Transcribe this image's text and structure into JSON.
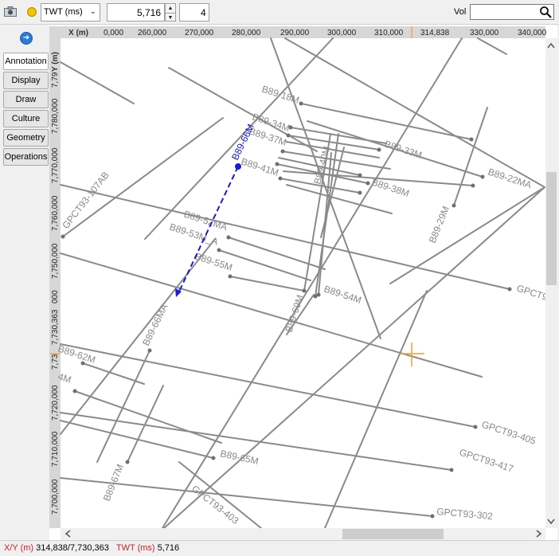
{
  "toolbar": {
    "domain_select": "TWT (ms)",
    "time_value": "5,716",
    "step_value": "4",
    "vol_label": "Vol",
    "vol_value": ""
  },
  "sidetabs": [
    "Annotation",
    "Display",
    "Draw",
    "Culture",
    "Geometry",
    "Operations"
  ],
  "axes": {
    "x_title": "X (m)",
    "y_title": "Y (m)",
    "x_ticks": [
      "0,000",
      "260,000",
      "270,000",
      "280,000",
      "290,000",
      "300,000",
      "310,000",
      "314,838",
      "330,000",
      "340,000"
    ],
    "y_ticks": [
      "7,79",
      "7,780,000",
      "7,770,000",
      "7,760,000",
      "7,750,000",
      "000",
      "7,730,363",
      "7,73",
      "7,720,000",
      "7,710,000",
      "7,700,000"
    ]
  },
  "map_labels": {
    "l1": "B89-18M",
    "l2": "B89-34M",
    "l3": "B89-37M",
    "l4": "B89-41M",
    "l5": "B89-33M",
    "l6": "B89-22MA",
    "l7": "B89-38M",
    "l8": "B89-29M",
    "l9": "B89-40M",
    "l10": "GPCT93-107AB",
    "l11": "B89-52MA",
    "l12": "B89-53M_A",
    "l13": "B89-55M",
    "l14": "B89-54M",
    "l15": "B89-69M",
    "l16": "B89-66MA",
    "l17": "GPCT9",
    "l18": "B89-62M",
    "l19": "4M",
    "l20": "GPCT93-405",
    "l21": "GPCT93-417",
    "l22": "B89-65M",
    "l23": "B89-67M",
    "l24": "GPCT93-403",
    "l25": "GPCT93-302",
    "selected": "B89-66M"
  },
  "colors": {
    "line": "#8a8a8a",
    "label": "#888888",
    "selected": "#1a1ad8",
    "cursor": "#f0a030"
  },
  "status": {
    "xy_label": "X/Y (m)",
    "xy_value": "314,838/7,730,363",
    "twt_label": "TWT (ms)",
    "twt_value": "5,716"
  }
}
